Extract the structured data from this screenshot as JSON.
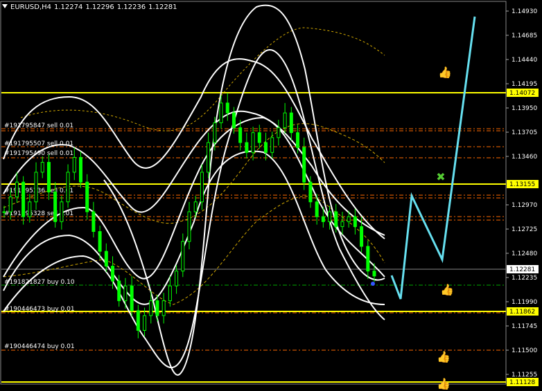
{
  "header": {
    "symbol": "EURUSD,H4",
    "open": "1.12274",
    "high": "1.12296",
    "low": "1.12236",
    "close": "1.12281"
  },
  "colors": {
    "background": "#000000",
    "candle": "#00ff00",
    "bands": "#ffffff",
    "ma": "#d4aa00",
    "level_line": "#ffff00",
    "order_line": "#ff6a00",
    "buy_line": "#00aa00",
    "arrow": "#66e0f0",
    "price_tag_bg": "#ffff00"
  },
  "price_axis": {
    "labels": [
      "1.14930",
      "1.14685",
      "1.14440",
      "1.14195",
      "1.13950",
      "1.13705",
      "1.13460",
      "1.12970",
      "1.12725",
      "1.12480",
      "1.12235",
      "1.11990",
      "1.11745",
      "1.11500",
      "1.11255"
    ],
    "tags": [
      {
        "label": "1.14072",
        "kind": "level"
      },
      {
        "label": "1.13155",
        "kind": "level"
      },
      {
        "label": "1.12281",
        "kind": "current"
      },
      {
        "label": "1.11862",
        "kind": "level"
      },
      {
        "label": "1.11128",
        "kind": "level"
      }
    ]
  },
  "order_labels": [
    {
      "text": "#191795847 sell 0.01"
    },
    {
      "text": "#191795507 sell 0.01"
    },
    {
      "text": "#191795490 sell 0.01"
    },
    {
      "text": "#191795336 sell 0.01"
    },
    {
      "text": "#191795328 sell 0.01"
    },
    {
      "text": "#191821827 buy 0.10"
    },
    {
      "text": "#190446473 buy 0.01"
    },
    {
      "text": "#190446474 buy 0.01"
    }
  ],
  "chart_data": {
    "type": "candlestick",
    "symbol": "EURUSD",
    "timeframe": "H4",
    "ylim": [
      1.111,
      1.15
    ],
    "horizontal_levels": [
      1.14072,
      1.13155,
      1.11862,
      1.11128
    ],
    "current_price": 1.12281,
    "close_series": [
      1.129,
      1.1305,
      1.132,
      1.1285,
      1.13,
      1.133,
      1.134,
      1.131,
      1.128,
      1.13,
      1.133,
      1.1345,
      1.132,
      1.129,
      1.127,
      1.125,
      1.1235,
      1.122,
      1.12,
      1.1215,
      1.119,
      1.117,
      1.1185,
      1.12,
      1.1185,
      1.12,
      1.1215,
      1.123,
      1.126,
      1.129,
      1.13,
      1.133,
      1.136,
      1.138,
      1.14,
      1.139,
      1.1375,
      1.136,
      1.135,
      1.137,
      1.136,
      1.135,
      1.1365,
      1.1375,
      1.139,
      1.137,
      1.1355,
      1.132,
      1.13,
      1.1285,
      1.128,
      1.129,
      1.1275,
      1.128,
      1.1285,
      1.1275,
      1.1255,
      1.123,
      1.1225
    ]
  }
}
